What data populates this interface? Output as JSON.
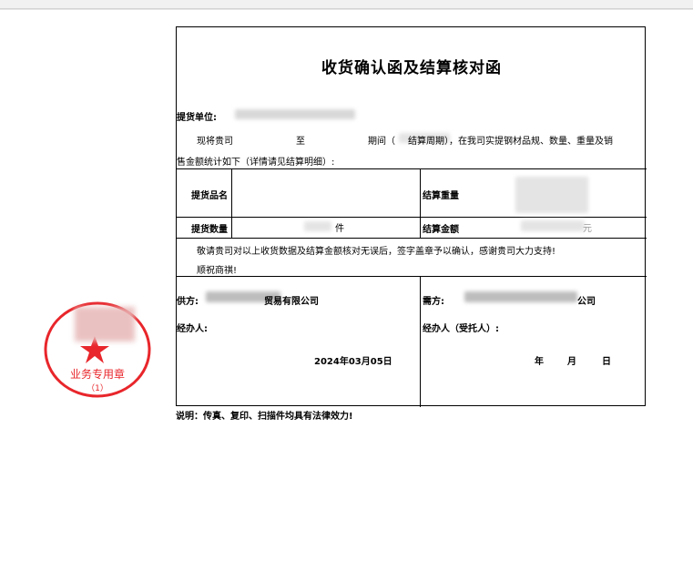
{
  "document": {
    "title": "收货确认函及结算核对函",
    "pickup_unit_label": "提货单位:",
    "intro": {
      "prefix": "现将贵司",
      "to": "至",
      "period": "期间（",
      "period_tail": "结算周期），在我司实提钢材品规、数量、重量及销",
      "line2": "售金额统计如下（详情请见结算明细）:"
    },
    "table": {
      "product_name_label": "提货品名",
      "settle_weight_label": "结算重量",
      "quantity_label": "提货数量",
      "settle_amount_label": "结算金额",
      "quantity_value_suffix": "件",
      "settle_amount_suffix": "元"
    },
    "confirm": {
      "line1": "敬请贵司对以上收货数据及结算金额核对无误后，签字盖章予以确认，感谢贵司大力支持!",
      "line2": "顺祝商祺!"
    },
    "supplier": {
      "label": "供方:",
      "name_suffix": "贸易有限公司",
      "handler_label": "经办人:",
      "date": "2024年03月05日"
    },
    "buyer": {
      "label": "需方:",
      "name_suffix": "公司",
      "handler_label": "经办人（受托人）:",
      "date_year": "年",
      "date_month": "月",
      "date_day": "日"
    },
    "footnote": "说明：传真、复印、扫描件均具有法律效力!"
  },
  "stamp": {
    "bottom_text": "业务专用章",
    "number": "（1）",
    "color": "#e8262b"
  }
}
